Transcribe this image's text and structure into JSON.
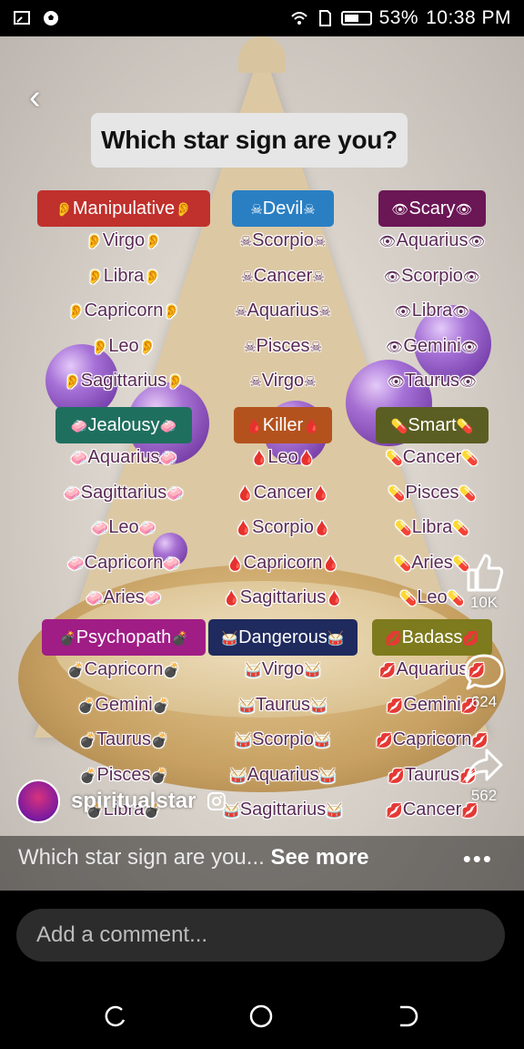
{
  "status_bar": {
    "battery": "53%",
    "time": "10:38 PM"
  },
  "post": {
    "question": "Which star sign are you?",
    "columns": [
      {
        "header": "Manipulative",
        "emoji": "👂",
        "color": "#c0302c",
        "items": [
          "Virgo",
          "Libra",
          "Capricorn",
          "Leo",
          "Sagittarius"
        ]
      },
      {
        "header": "Devil",
        "emoji": "☠",
        "color": "#2a7fc3",
        "items": [
          "Scorpio",
          "Cancer",
          "Aquarius",
          "Pisces",
          "Virgo"
        ]
      },
      {
        "header": "Scary",
        "emoji": "👁",
        "color": "#6b1655",
        "items": [
          "Aquarius",
          "Scorpio",
          "Libra",
          "Gemini",
          "Taurus"
        ]
      },
      {
        "header": "Jealousy",
        "emoji": "🧼",
        "color": "#1f6f5f",
        "items": [
          "Aquarius",
          "Sagittarius",
          "Leo",
          "Capricorn",
          "Aries"
        ]
      },
      {
        "header": "Killer",
        "emoji": "🩸",
        "color": "#b4521e",
        "items": [
          "Leo",
          "Cancer",
          "Scorpio",
          "Capricorn",
          "Sagittarius"
        ]
      },
      {
        "header": "Smart",
        "emoji": "💊",
        "color": "#5b5e22",
        "items": [
          "Cancer",
          "Pisces",
          "Libra",
          "Aries",
          "Leo"
        ]
      },
      {
        "header": "Psychopath",
        "emoji": "💣",
        "color": "#a01d86",
        "items": [
          "Capricorn",
          "Gemini",
          "Taurus",
          "Pisces",
          "Libra"
        ]
      },
      {
        "header": "Dangerous",
        "emoji": "🥁",
        "color": "#1f2a5e",
        "items": [
          "Virgo",
          "Taurus",
          "Scorpio",
          "Aquarius",
          "Sagittarius"
        ]
      },
      {
        "header": "Badass",
        "emoji": "💋",
        "color": "#7d7b1d",
        "items": [
          "Aquarius",
          "Gemini",
          "Capricorn",
          "Taurus",
          "Cancer"
        ]
      }
    ]
  },
  "actions": {
    "likes": "10K",
    "comments": "624",
    "shares": "562"
  },
  "author": {
    "username": "spiritualstar"
  },
  "caption": {
    "text": "Which star sign are you...",
    "more": "See more"
  },
  "comment_input": {
    "placeholder": "Add a comment..."
  }
}
